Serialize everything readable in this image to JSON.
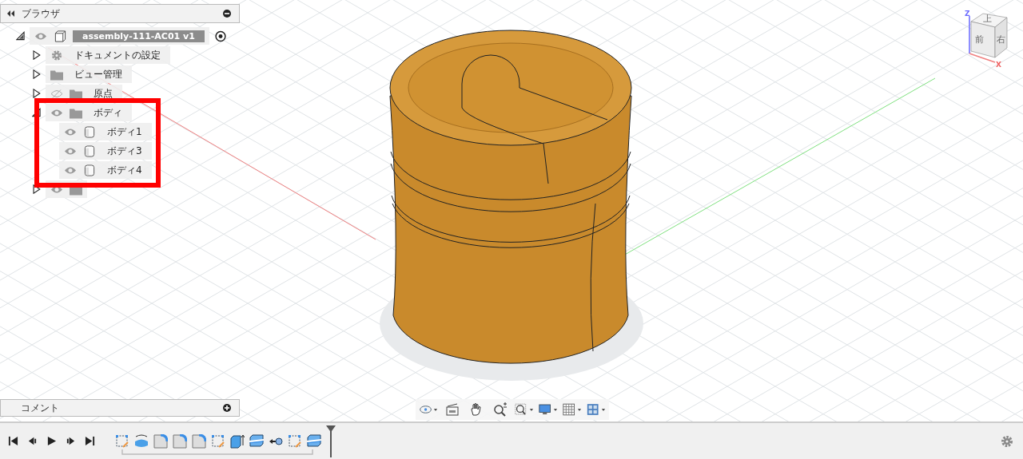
{
  "browser": {
    "title": "ブラウザ",
    "root": {
      "label": "assembly-111-AC01 v1",
      "kind": "component",
      "expanded": true,
      "visible": true,
      "children": [
        {
          "label": "ドキュメントの設定",
          "kind": "settings",
          "expanded": false
        },
        {
          "label": "ビュー管理",
          "kind": "folder",
          "expanded": false
        },
        {
          "label": "原点",
          "kind": "folder",
          "expanded": false,
          "visible": false
        },
        {
          "label": "ボディ",
          "kind": "folder",
          "expanded": true,
          "visible": true,
          "children": [
            {
              "label": "ボディ1",
              "kind": "body",
              "visible": true
            },
            {
              "label": "ボディ3",
              "kind": "body",
              "visible": true
            },
            {
              "label": "ボディ4",
              "kind": "body",
              "visible": true
            }
          ]
        },
        {
          "kind": "folder",
          "expanded": false,
          "visible": true
        }
      ]
    }
  },
  "comments": {
    "title": "コメント"
  },
  "view_cube": {
    "top": "上",
    "front": "前",
    "right": "右",
    "axes": [
      "Z",
      "X"
    ]
  },
  "timeline": {
    "features": [
      {
        "kind": "sketch"
      },
      {
        "kind": "revolve"
      },
      {
        "kind": "fillet"
      },
      {
        "kind": "fillet"
      },
      {
        "kind": "fillet"
      },
      {
        "kind": "sketch"
      },
      {
        "kind": "extrude"
      },
      {
        "kind": "split"
      },
      {
        "kind": "joint"
      },
      {
        "kind": "sketch"
      },
      {
        "kind": "split"
      }
    ]
  }
}
